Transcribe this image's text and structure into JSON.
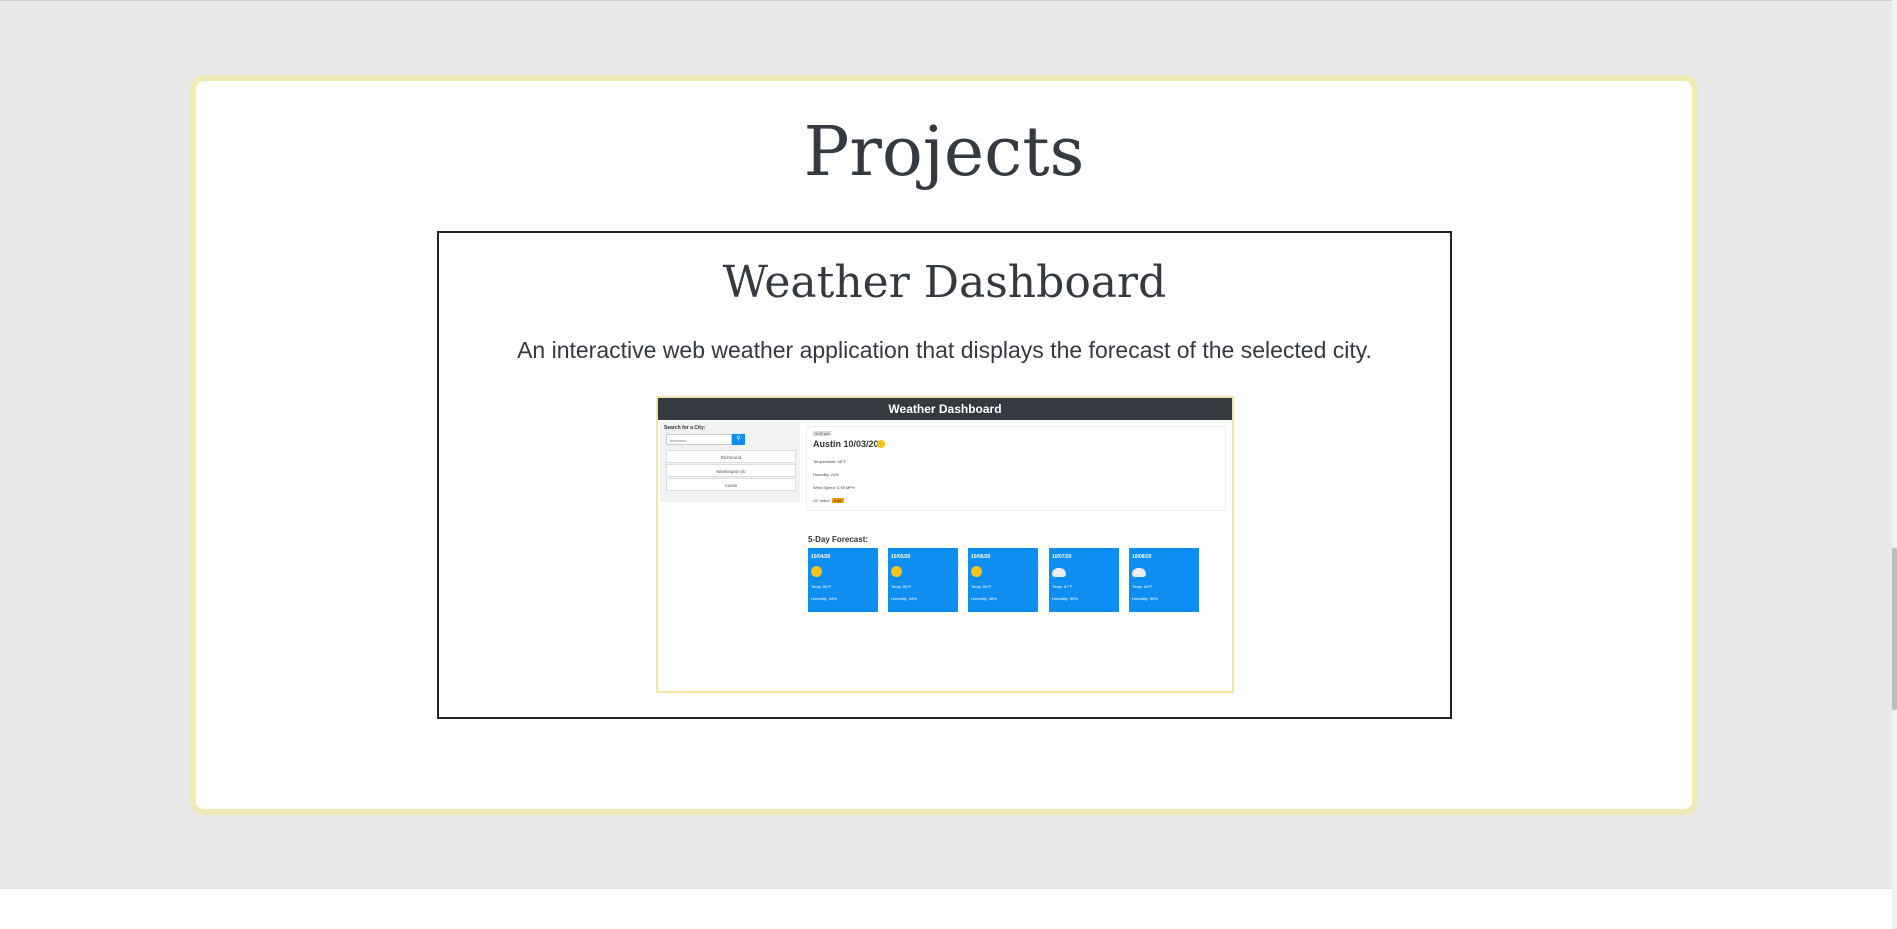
{
  "projects": {
    "title": "Projects",
    "items": [
      {
        "title": "Weather Dashboard",
        "description": "An interactive web weather application that displays the forecast of the selected city.",
        "screenshot": {
          "header": "Weather Dashboard",
          "search_label": "Search for a City:",
          "search_value": "richmond",
          "search_icon": "search-icon",
          "history": [
            "Richmond",
            "Washington dc",
            "Austin"
          ],
          "time": "3:02 pm",
          "current_city": "Austin 10/03/20",
          "temperature": "Temperature: 66°F",
          "humidity": "Humidity: 24%",
          "wind": "Wind Speed: 5.99 MPH",
          "uv_label": "UV Index:",
          "uv_value": "5.66",
          "forecast_title": "5-Day Forecast:",
          "forecast": [
            {
              "date": "10/04/20",
              "icon": "sun-icon",
              "temp": "Temp: 66°F",
              "humidity": "Humidity: 34%"
            },
            {
              "date": "10/05/20",
              "icon": "sun-icon",
              "temp": "Temp: 65°F",
              "humidity": "Humidity: 34%"
            },
            {
              "date": "10/06/20",
              "icon": "sun-icon",
              "temp": "Temp: 68°F",
              "humidity": "Humidity: 46%"
            },
            {
              "date": "10/07/20",
              "icon": "cloud-icon",
              "temp": "Temp: 67°F",
              "humidity": "Humidity: 39%"
            },
            {
              "date": "10/08/20",
              "icon": "cloud-icon",
              "temp": "Temp: 66°F",
              "humidity": "Humidity: 35%"
            }
          ]
        }
      }
    ]
  },
  "colors": {
    "page_bg": "#e9e9e9",
    "card_border": "#efeab6",
    "text": "#343a40",
    "accent_blue": "#0d8ef0"
  }
}
